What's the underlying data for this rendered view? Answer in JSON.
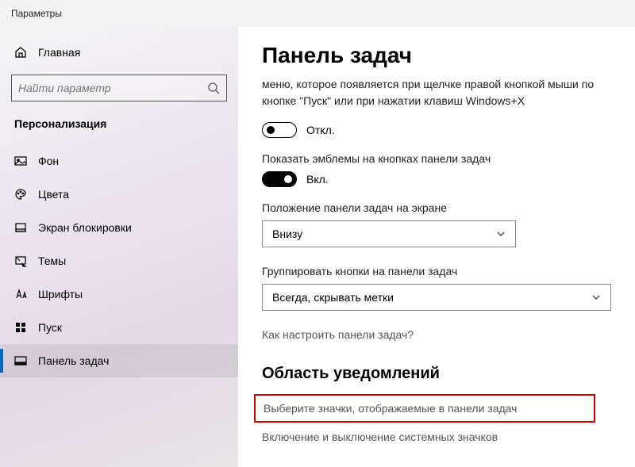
{
  "window": {
    "title": "Параметры"
  },
  "sidebar": {
    "home_label": "Главная",
    "search_placeholder": "Найти параметр",
    "section": "Персонализация",
    "items": [
      {
        "label": "Фон"
      },
      {
        "label": "Цвета"
      },
      {
        "label": "Экран блокировки"
      },
      {
        "label": "Темы"
      },
      {
        "label": "Шрифты"
      },
      {
        "label": "Пуск"
      },
      {
        "label": "Панель задач"
      }
    ],
    "selected_index": 6
  },
  "main": {
    "title": "Панель задач",
    "clipped_paragraph": "Заменить командную строку оболочкой Windows PowerShell в меню, которое появляется при щелчке правой кнопкой мыши по кнопке \"Пуск\" или при нажатии клавиш Windows+X",
    "toggle1": {
      "state": "off",
      "label": "Откл."
    },
    "setting2_label": "Показать эмблемы на кнопках панели задач",
    "toggle2": {
      "state": "on",
      "label": "Вкл."
    },
    "position_label": "Положение панели задач на экране",
    "position_value": "Внизу",
    "grouping_label": "Группировать кнопки на панели задач",
    "grouping_value": "Всегда, скрывать метки",
    "help_link": "Как настроить панели задач?",
    "subheading": "Область уведомлений",
    "link_highlight": "Выберите значки, отображаемые в панели задач",
    "link_plain": "Включение и выключение системных значков"
  }
}
